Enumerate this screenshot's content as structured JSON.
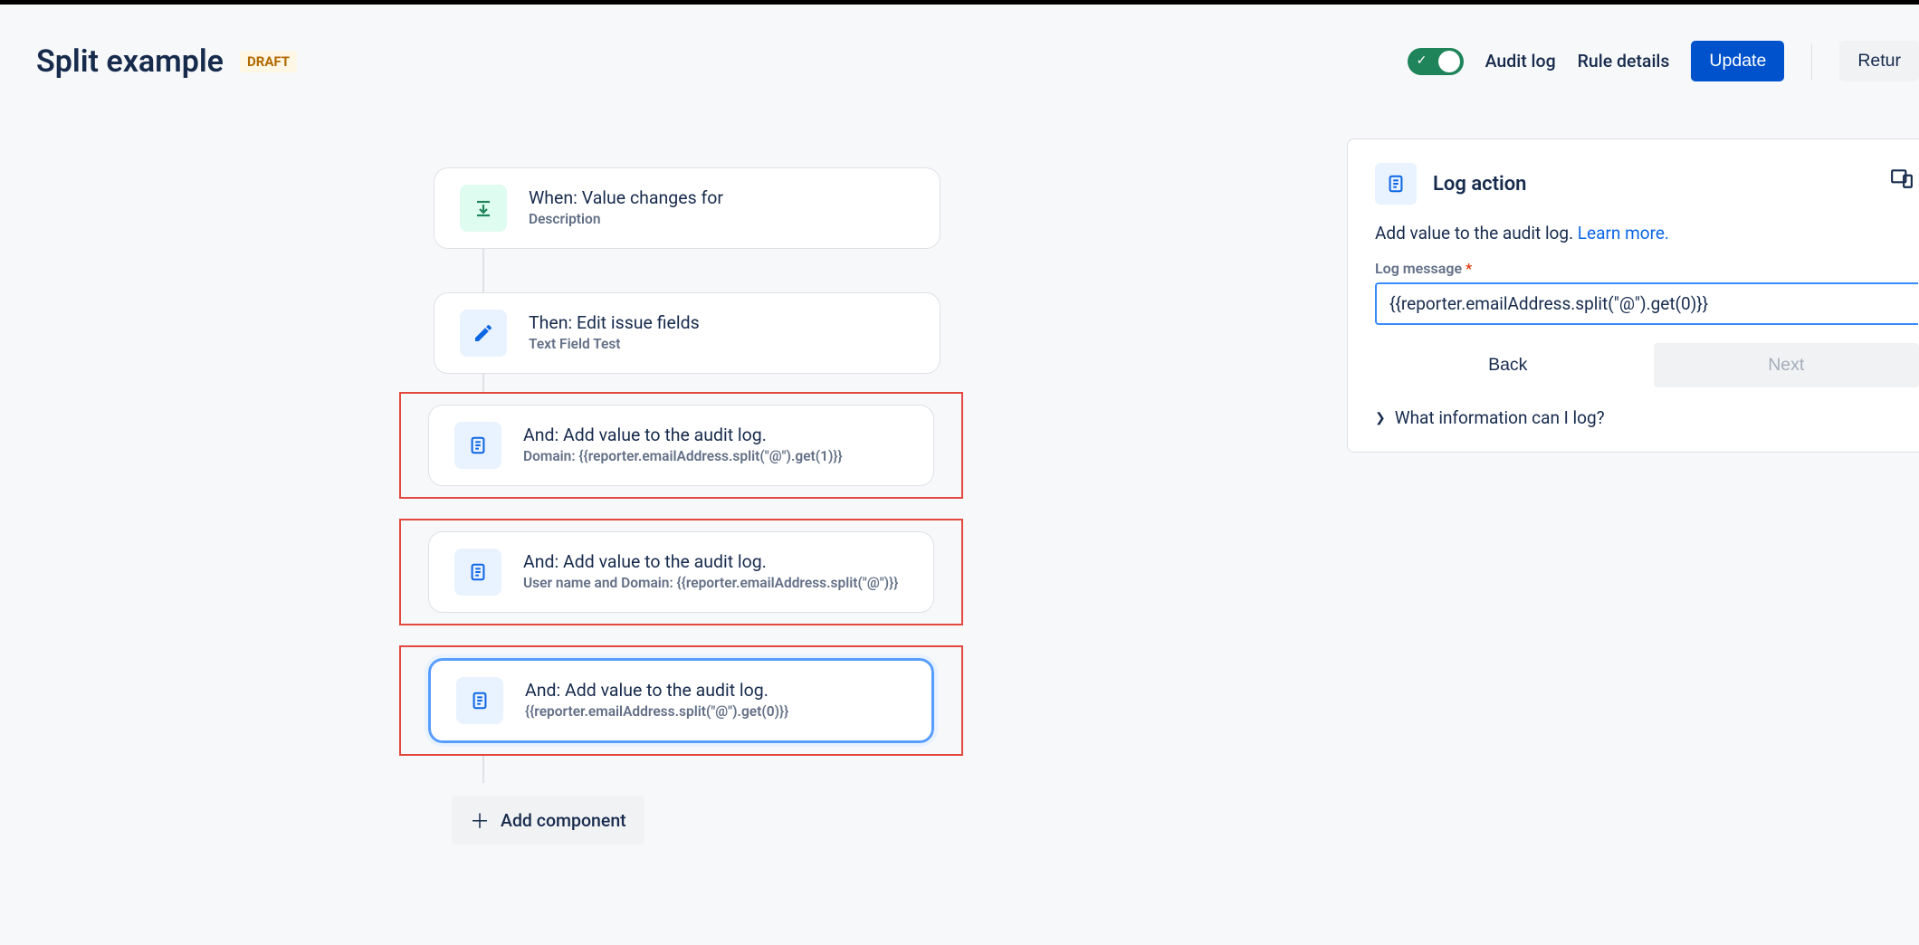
{
  "header": {
    "title": "Split example",
    "badge": "DRAFT",
    "actions": {
      "audit_log": "Audit log",
      "rule_details": "Rule details",
      "update": "Update",
      "return": "Retur"
    }
  },
  "flow": {
    "trigger": {
      "title": "When: Value changes for",
      "sub": "Description"
    },
    "edit": {
      "title": "Then: Edit issue fields",
      "sub": "Text Field Test"
    },
    "log1": {
      "title": "And: Add value to the audit log.",
      "sub": "Domain: {{reporter.emailAddress.split(\"@\").get(1)}}"
    },
    "log2": {
      "title": "And: Add value to the audit log.",
      "sub": "User name and Domain: {{reporter.emailAddress.split(\"@\")}}"
    },
    "log3": {
      "title": "And: Add value to the audit log.",
      "sub": "{{reporter.emailAddress.split(\"@\").get(0)}}"
    },
    "add_component": "Add component"
  },
  "panel": {
    "title": "Log action",
    "desc_text": "Add value to the audit log. ",
    "learn_more": "Learn more.",
    "field_label": "Log message",
    "input_value": "{{reporter.emailAddress.split(\"@\").get(0)}}",
    "back": "Back",
    "next": "Next",
    "expander": "What information can I log?"
  }
}
